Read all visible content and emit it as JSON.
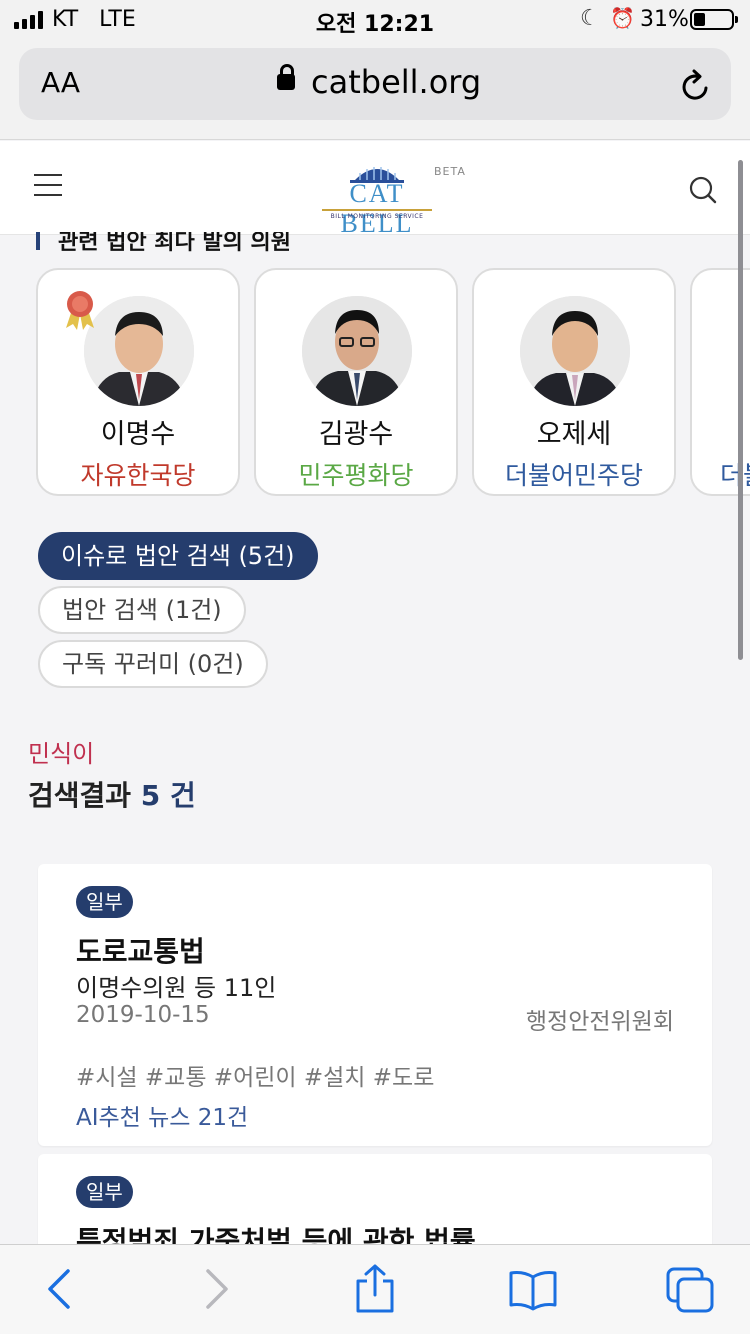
{
  "status_bar": {
    "carrier": "KT",
    "network": "LTE",
    "time": "오전 12:21",
    "battery_percent": "31%",
    "battery_level": 0.31
  },
  "browser": {
    "text_size_label": "AA",
    "url": "catbell.org"
  },
  "site": {
    "logo_text": "CAT BELL",
    "logo_subtitle": "BILL MONITORING SERVICE",
    "beta_label": "BETA"
  },
  "section": {
    "heading": "관련 법안 최다 발의 의원"
  },
  "legislators": [
    {
      "name": "이명수",
      "party": "자유한국당",
      "party_color": "#c0392b",
      "featured": true
    },
    {
      "name": "김광수",
      "party": "민주평화당",
      "party_color": "#5aa845",
      "featured": false
    },
    {
      "name": "오제세",
      "party": "더불어민주당",
      "party_color": "#2f5a9e",
      "featured": false
    },
    {
      "name": "",
      "party": "더불",
      "party_color": "#2f5a9e",
      "featured": false
    }
  ],
  "search_buttons": [
    {
      "label": "이슈로 법안 검색 (5건)",
      "active": true
    },
    {
      "label": "법안 검색 (1건)",
      "active": false
    },
    {
      "label": "구독 꾸러미 (0건)",
      "active": false
    }
  ],
  "results": {
    "keyword": "민식이",
    "label_prefix": "검색결과",
    "count": "5 건"
  },
  "bills": [
    {
      "tag": "일부",
      "title": "도로교통법",
      "proposer": "이명수의원 등 11인",
      "date": "2019-10-15",
      "committee": "행정안전위원회",
      "hashtags": "#시설 #교통 #어린이 #설치 #도로",
      "news": "AI추천 뉴스 21건"
    },
    {
      "tag": "일부",
      "title": "특정범죄 가중처벌 등에 관한 법률"
    }
  ],
  "colors": {
    "brand": "#253d6d",
    "keyword": "#c0304f",
    "link": "#1a6fe0"
  }
}
